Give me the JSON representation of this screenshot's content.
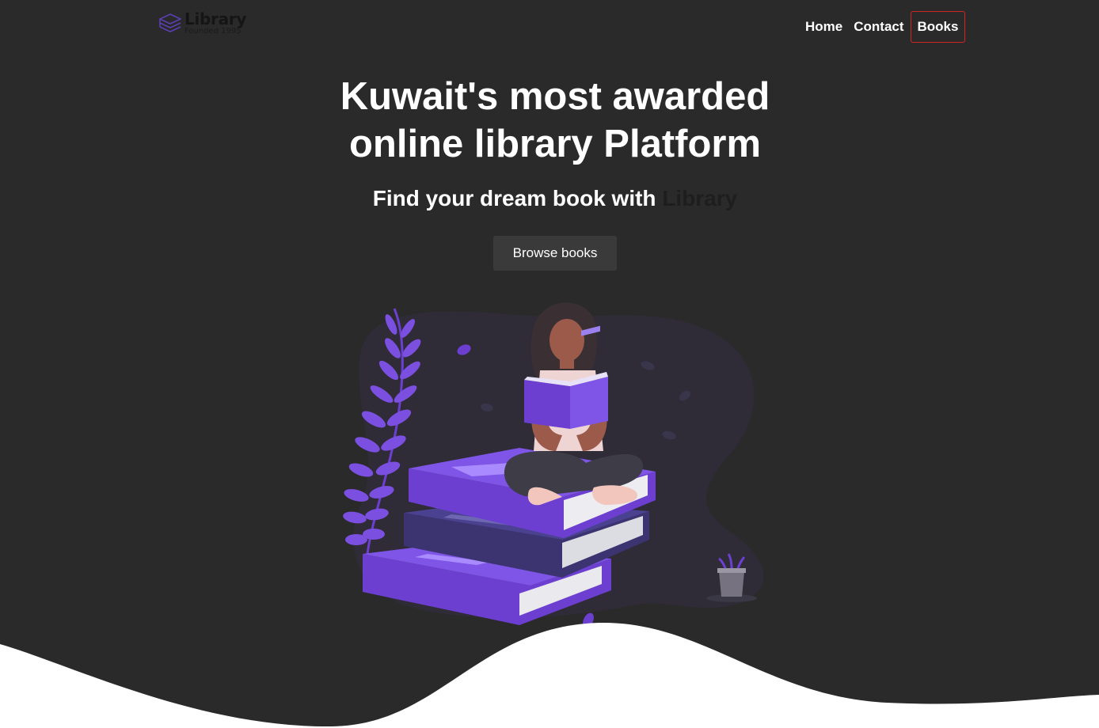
{
  "brand": {
    "name": "Library",
    "tagline": "Founded 1995",
    "icon": "books-stack-icon"
  },
  "nav": {
    "items": [
      {
        "label": "Home",
        "active": false
      },
      {
        "label": "Contact",
        "active": false
      },
      {
        "label": "Books",
        "active": true
      }
    ]
  },
  "hero": {
    "title_line1": "Kuwait's most awarded",
    "title_line2": "online library Platform",
    "subtitle_prefix": "Find your dream book with ",
    "subtitle_highlight": "Library",
    "button_label": "Browse books"
  },
  "colors": {
    "background": "#2a2a2a",
    "accent_purple": "#6c3fd1",
    "active_border": "#d32424",
    "button_bg": "#3a3a3a",
    "wave": "#ffffff"
  },
  "illustration": "woman-reading-on-book-stack-illustration"
}
